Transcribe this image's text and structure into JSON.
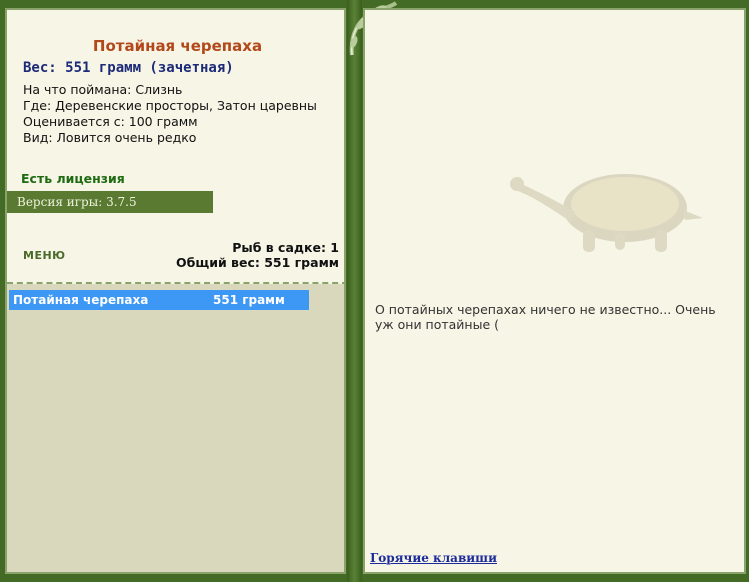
{
  "fish": {
    "title": "Потайная черепаха",
    "weight_line": "Вес: 551 грамм (зачетная)",
    "caught_on": "На что поймана: Слизнь",
    "where": "Где: Деревенские просторы, Затон царевны",
    "valued_from": "Оценивается с: 100 грамм",
    "kind": "Вид: Ловится очень редко"
  },
  "license": "Есть лицензия",
  "version": "Версия игры: 3.7.5",
  "menu_label": "МЕНЮ",
  "stats": {
    "fish_count": "Рыб в садке: 1",
    "total_weight": "Общий вес: 551 грамм"
  },
  "catch_list": [
    {
      "name": "Потайная черепаха",
      "weight": "551 грамм"
    }
  ],
  "description": "О потайных черепахах ничего не известно... Очень уж они потайные (",
  "hotkeys_label": "Горячие клавиши",
  "colors": {
    "title": "#b3481a",
    "weight": "#1c2a78",
    "license": "#1e6b12",
    "selected_row": "#3d98f5",
    "frame": "#436b26"
  }
}
